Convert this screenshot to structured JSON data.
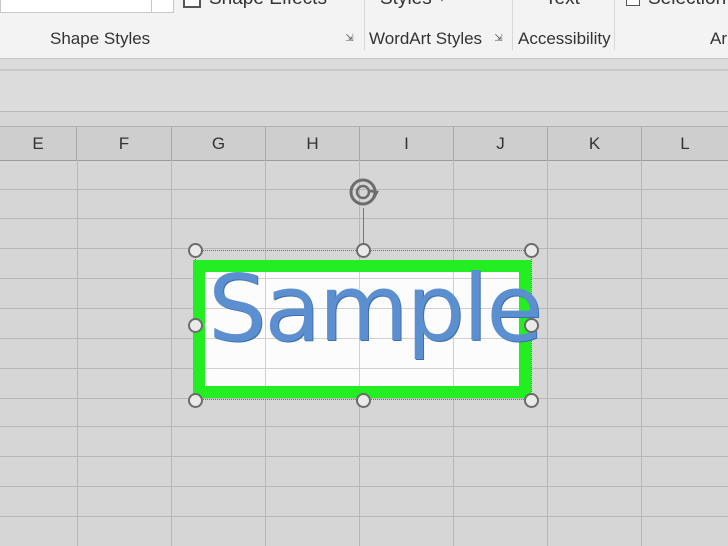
{
  "ribbon": {
    "shape_effects_label": "Shape Effects",
    "wordart_styles_button_label": "Styles",
    "text_button_label": "Text",
    "selection_pane_label": "Selection",
    "arrange_partial_label": "Ar",
    "groups": {
      "shape_styles": "Shape Styles",
      "wordart_styles": "WordArt Styles",
      "accessibility": "Accessibility"
    }
  },
  "spreadsheet": {
    "columns": [
      "E",
      "F",
      "G",
      "H",
      "I",
      "J",
      "K",
      "L"
    ]
  },
  "textbox": {
    "text": "Sample",
    "text_color": "#5b8fcf",
    "highlight_color": "#22ee22"
  },
  "icons": [
    "rotate-handle-icon",
    "dropdown-arrow-icon",
    "dialog-launcher-icon",
    "selection-pane-icon",
    "alt-text-icon"
  ]
}
